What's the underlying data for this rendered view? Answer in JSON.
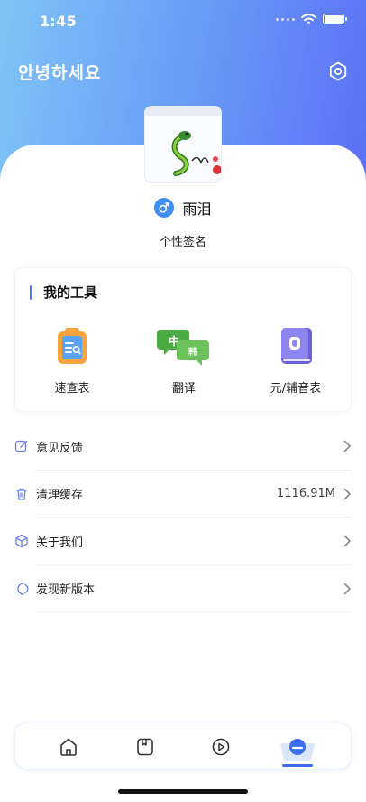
{
  "status_bar": {
    "time": "1:45"
  },
  "header": {
    "greeting": "안녕하세요"
  },
  "profile": {
    "username": "雨泪",
    "signature": "个性签名"
  },
  "tools": {
    "title": "我的工具",
    "items": [
      {
        "label": "速查表",
        "icon": "quick-reference-icon"
      },
      {
        "label": "翻译",
        "icon": "translate-icon"
      },
      {
        "label": "元/辅音表",
        "icon": "vowel-consonant-book-icon"
      }
    ]
  },
  "menu": [
    {
      "label": "意见反馈",
      "icon": "edit-icon",
      "value": ""
    },
    {
      "label": "清理缓存",
      "icon": "trash-icon",
      "value": "1116.91M"
    },
    {
      "label": "关于我们",
      "icon": "cube-icon",
      "value": ""
    },
    {
      "label": "发现新版本",
      "icon": "version-icon",
      "value": ""
    }
  ],
  "tabbar": {
    "tabs": [
      {
        "name": "home",
        "icon": "home-icon"
      },
      {
        "name": "book",
        "icon": "book-icon"
      },
      {
        "name": "video",
        "icon": "play-icon"
      },
      {
        "name": "profile",
        "icon": "profile-icon",
        "active": true
      }
    ]
  },
  "colors": {
    "accent": "#4b7cf6",
    "gradient_start": "#7fc4f6",
    "gradient_end": "#5b6ff5"
  }
}
